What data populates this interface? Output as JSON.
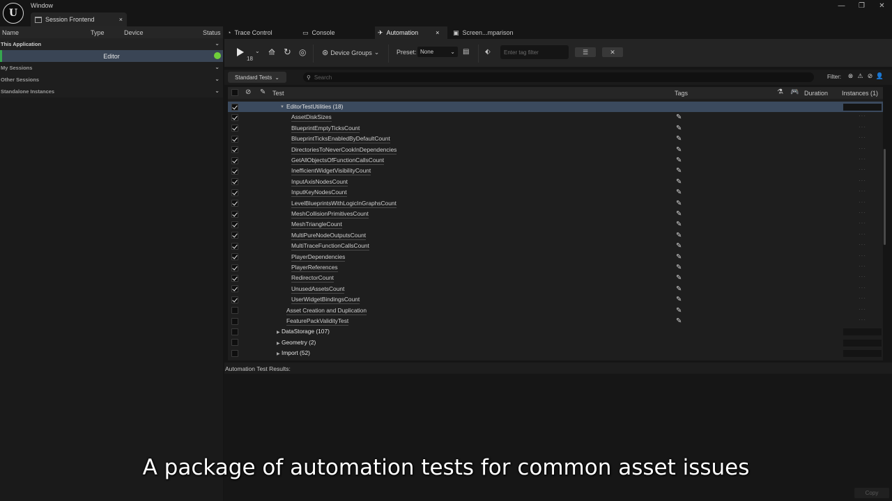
{
  "window": {
    "menu": "Window",
    "tab_title": "Session Frontend",
    "tab_close": "×"
  },
  "window_controls": [
    "—",
    "❐",
    "✕"
  ],
  "sessions": {
    "columns": [
      "Name",
      "Type",
      "Device",
      "Status"
    ],
    "this_application": "This Application",
    "editor_instance": "Editor",
    "my_sessions": "My Sessions",
    "other_sessions": "Other Sessions",
    "standalone_instances": "Standalone Instances"
  },
  "tabs": [
    {
      "label": "Trace Control",
      "icon": "trace-icon"
    },
    {
      "label": "Console",
      "icon": "console-icon"
    },
    {
      "label": "Automation",
      "icon": "automation-icon",
      "active": true
    },
    {
      "label": "Screen...mparison",
      "icon": "screen-icon"
    }
  ],
  "toolbar": {
    "run_count": "18",
    "device_groups": "Device Groups",
    "preset_label": "Preset:",
    "preset_value": "None",
    "tag_filter_placeholder": "Enter tag filter"
  },
  "filterbar": {
    "test_type": "Standard Tests",
    "search_placeholder": "Search",
    "filter_label": "Filter:"
  },
  "table": {
    "col_test": "Test",
    "col_tags": "Tags",
    "col_duration": "Duration",
    "col_instances": "Instances (1)",
    "group": "EditorTestUtilities (18)",
    "leaves": [
      "AssetDiskSizes",
      "BlueprintEmptyTicksCount",
      "BlueprintTicksEnabledByDefaultCount",
      "DirectoriesToNeverCookInDependencies",
      "GetAllObjectsOfFunctionCallsCount",
      "InefficientWidgetVisibilityCount",
      "InputAxisNodesCount",
      "InputKeyNodesCount",
      "LevelBlueprintsWithLogicInGraphsCount",
      "MeshCollisionPrimitivesCount",
      "MeshTriangleCount",
      "MultiPureNodeOutputsCount",
      "MultiTraceFunctionCallsCount",
      "PlayerDependencies",
      "PlayerReferences",
      "RedirectorCount",
      "UnusedAssetsCount",
      "UserWidgetBindingsCount"
    ],
    "siblings": [
      "Asset Creation and Duplication",
      "FeaturePackValidityTest"
    ],
    "collapsed_groups": [
      "DataStorage (107)",
      "Geometry (2)",
      "Import (52)"
    ]
  },
  "results": {
    "header": "Automation Test Results:",
    "copy": "Copy"
  },
  "subtitle": "A package of automation tests for common asset issues"
}
